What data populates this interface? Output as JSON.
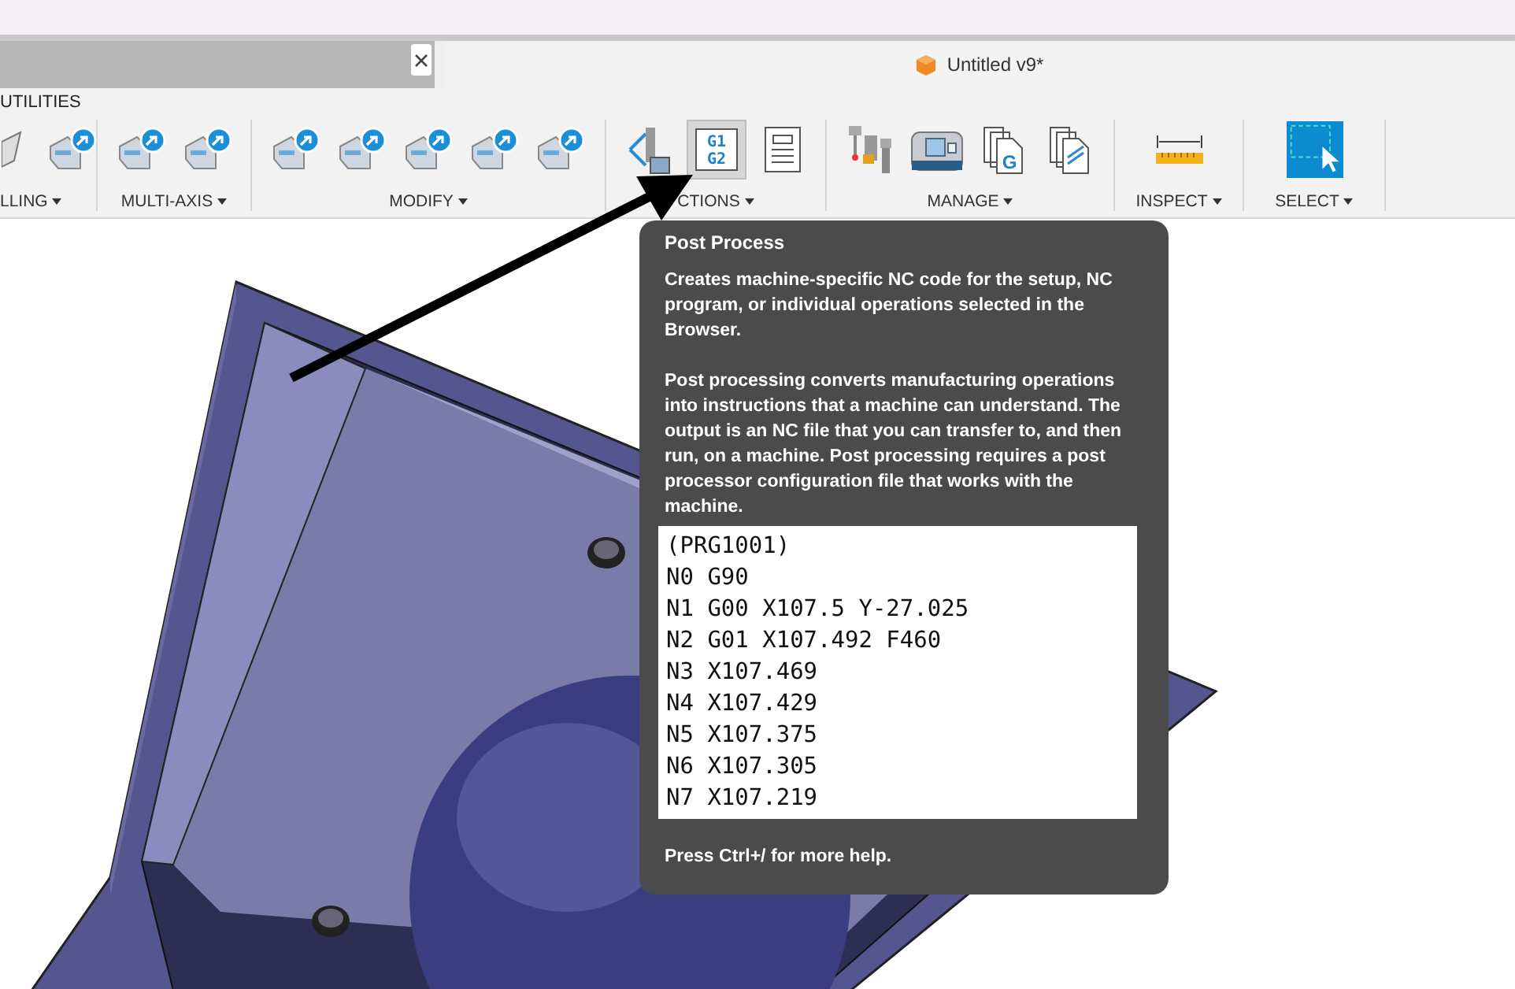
{
  "document_tabs": [
    {
      "closable": true,
      "selected": false
    },
    {
      "title": "Untitled v9*",
      "closable": false,
      "selected": true
    }
  ],
  "workspace_tab": "UTILITIES",
  "toolbar": {
    "groups": [
      {
        "label": "LLING",
        "tools": [
          {
            "kind": "partial",
            "highlighted": false
          },
          {
            "kind": "plug",
            "highlighted": false
          }
        ]
      },
      {
        "label": "MULTI-AXIS",
        "tools": [
          {
            "kind": "plug",
            "highlighted": false
          },
          {
            "kind": "plug",
            "highlighted": false
          }
        ]
      },
      {
        "label": "MODIFY",
        "tools": [
          {
            "kind": "plug",
            "highlighted": false
          },
          {
            "kind": "plug",
            "highlighted": false
          },
          {
            "kind": "plug",
            "highlighted": false
          },
          {
            "kind": "plug",
            "highlighted": false
          },
          {
            "kind": "plug",
            "highlighted": false
          }
        ]
      },
      {
        "label": "CTIONS",
        "tools": [
          {
            "kind": "simulate",
            "highlighted": false
          },
          {
            "kind": "gcode",
            "text": [
              "G1",
              "G2"
            ],
            "highlighted": true
          },
          {
            "kind": "sheet",
            "highlighted": false
          }
        ]
      },
      {
        "label": "MANAGE",
        "tools": [
          {
            "kind": "tool-library",
            "highlighted": false
          },
          {
            "kind": "machine",
            "highlighted": false
          },
          {
            "kind": "gfile",
            "text": [
              "G"
            ],
            "highlighted": false
          },
          {
            "kind": "sfile",
            "highlighted": false
          }
        ]
      },
      {
        "label": "INSPECT",
        "tools": [
          {
            "kind": "ruler",
            "highlighted": false
          }
        ]
      },
      {
        "label": "SELECT",
        "tools": [
          {
            "kind": "select",
            "highlighted": false
          }
        ]
      }
    ]
  },
  "tooltip": {
    "title": "Post Process",
    "paragraphs": [
      "Creates machine-specific NC code for the setup, NC program, or individual operations selected in the Browser.",
      "Post processing converts manufacturing operations into instructions that a machine can understand. The output is an NC file that you can transfer to, and then run, on a machine. Post processing requires a post processor configuration file that works with the machine."
    ],
    "code_lines": [
      "(PRG1001)",
      "N0 G90",
      "N1 G00 X107.5 Y-27.025",
      "N2 G01 X107.492 F460",
      "N3 X107.469",
      "N4 X107.429",
      "N5 X107.375",
      "N6 X107.305",
      "N7 X107.219"
    ],
    "footer": "Press Ctrl+/ for more help."
  }
}
